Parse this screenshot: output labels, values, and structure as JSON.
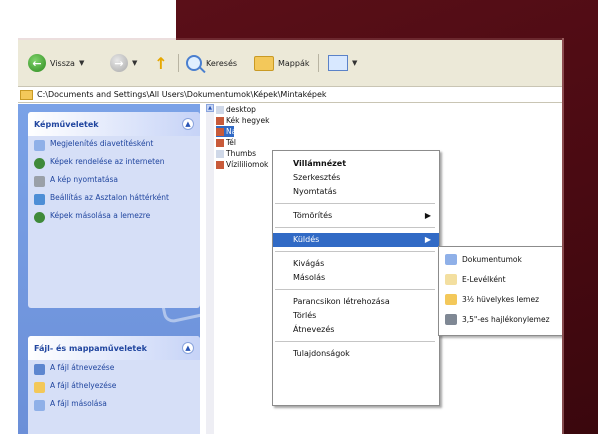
{
  "toolbar": {
    "back_label": "Vissza",
    "search_label": "Keresés",
    "folders_label": "Mappák"
  },
  "address": {
    "path": "C:\\Documents and Settings\\All Users\\Dokumentumok\\Képek\\Mintaképek"
  },
  "tasks_panel": {
    "picture_tasks_title": "Képműveletek",
    "picture_tasks": [
      "Megjelenítés diavetítésként",
      "Képek rendelése az interneten",
      "A kép nyomtatása",
      "Beállítás az Asztalon háttérként",
      "Képek másolása a lemezre"
    ],
    "file_tasks_title": "Fájl- és mappaműveletek",
    "file_tasks": [
      "A fájl átnevezése",
      "A fájl áthelyezése",
      "A fájl másolása"
    ]
  },
  "files": [
    "desktop",
    "Kék hegyek",
    "Naplemente",
    "Tél",
    "Thumbs",
    "Vízililiomok"
  ],
  "context_menu": {
    "items": [
      {
        "label": "Villámnézet",
        "bold": true
      },
      {
        "label": "Szerkesztés"
      },
      {
        "label": "Nyomtatás"
      },
      {
        "label": "Tömörítés",
        "submenu": true
      },
      {
        "label": "Küldés",
        "submenu": true,
        "highlight": true
      },
      {
        "label": "Kivágás"
      },
      {
        "label": "Másolás"
      },
      {
        "label": "Parancsikon létrehozása"
      },
      {
        "label": "Törlés"
      },
      {
        "label": "Átnevezés"
      },
      {
        "label": "Tulajdonságok"
      }
    ]
  },
  "send_to_menu": {
    "items": [
      "Dokumentumok",
      "E-Levélként",
      "3½ hüvelykes lemez",
      "3,5\"-es hajlékonylemez"
    ]
  }
}
